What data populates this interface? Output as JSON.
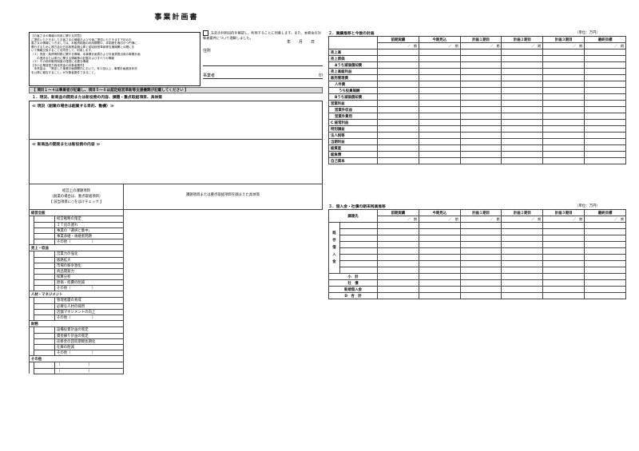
{
  "title": "事業計画書",
  "notice_lines": [
    "【お客さまの情報の利用に関する同意】",
    "ご提供いただきましたお客さまの情報および今後ご提供いただきます下記のお",
    "客さまの情報につきましては、本融資制度の利用期間中、本制度を適切かつ円滑に",
    "履行するために株式会社日本政策金融公庫と認定経営革新等支援機関との間にお",
    "いて情報交換することを同意して、利用します。",
    "（１）資産・負債等財務に関する情報、本事業計画書および計画書提出後の事業計画",
    "　　の進捗または実行に関する情報等の記載およびすべての情報",
    "（２）その他本融資制度の運営に必要な情報",
    "【中小企業経営力強化資金の対象者要件】",
    "　本資金は、「策定した事業計画期間内において、年１回以上、事業計画進捗状況",
    "を公庫に報告すること」が対象者要件であること。"
  ],
  "consent": {
    "text": "左記の利用目的を確認し、利用することに同意します。また、本資金の対象者要件について理解しました。",
    "date": "年　　月　　日",
    "address_label": "住所",
    "applicant_label": "事業者",
    "seal": "印"
  },
  "band_note": "【 項目１～４は事業者が記載し、項目５～６は認定経営革新等支援機関が記載してください 】",
  "section1": {
    "heading": "１．現況、新商品の開発または新役務の内容、課題・重点取組項目、具体策",
    "box1_label": "≪ 現況（創業の場合は創業する目的、動機）≫",
    "box2_label": "≪ 新商品の開発または新役務の内容 ≫"
  },
  "issues": {
    "header_left_1": "経営上の課題項目",
    "header_left_2": "（創業の場合は、重点取組項目）",
    "header_left_3": "【 該当項目に○をはけチェック 】",
    "header_right": "課題項目または重点取組項目を踏まえた具体策",
    "categories": [
      {
        "name": "経営全般",
        "items": [
          "経営戦略の策定",
          "ＩＴ化の遅れ",
          "事業の「選択と集中」",
          "事業承継・後継者問題",
          "その他（　　　　　　）"
        ]
      },
      {
        "name": "売上・収益",
        "items": [
          "営業力の強化",
          "販路拡大",
          "市場の競争激化",
          "商品開発力",
          "採算分析",
          "原価・経費の削減",
          "その他（　　　　　　）"
        ]
      },
      {
        "name": "人材・マネジメント",
        "items": [
          "管理者層の育成",
          "必要な人材の採用",
          "店舗マネジメントの向上",
          "その他（　　　　　　）"
        ]
      },
      {
        "name": "財務",
        "items": [
          "設備投資計画の策定",
          "資金繰り計画の策定",
          "売掛金の回収期間長期化",
          "在庫の削減",
          "その他（　　　　　　）"
        ]
      },
      {
        "name": "その他",
        "items": [
          "（　　　　　　　　）",
          "（　　　　　　　　）"
        ]
      }
    ]
  },
  "section2": {
    "heading": "２．業績推移と今後の計画",
    "unit": "（単位：万円）",
    "columns": [
      "前期実績",
      "今期見込",
      "計画１期目",
      "計画２期目",
      "計画３期目",
      "最終目標"
    ],
    "period_cell": "／　期",
    "rows": [
      {
        "label": "売上高",
        "indent": 0
      },
      {
        "label": "売上原価",
        "indent": 0
      },
      {
        "label": "Aうち減価償却費",
        "indent": 1
      },
      {
        "label": "売上高総利益",
        "indent": 0
      },
      {
        "label": "販売管理費",
        "indent": 0
      },
      {
        "label": "人件費",
        "indent": 1
      },
      {
        "label": "うち役員報酬",
        "indent": 2
      },
      {
        "label": "Bうち減価償却費",
        "indent": 1
      },
      {
        "label": "営業利益",
        "indent": 0
      },
      {
        "label": "営業外収益",
        "indent": 1
      },
      {
        "label": "営業外費用",
        "indent": 1
      },
      {
        "label": "C 経常利益",
        "indent": 0
      },
      {
        "label": "特別損益",
        "indent": 0
      },
      {
        "label": "法人税等",
        "indent": 0
      },
      {
        "label": "当期利益",
        "indent": 0
      },
      {
        "label": "総資産",
        "indent": 0
      },
      {
        "label": "総負債",
        "indent": 0
      },
      {
        "label": "自己資本",
        "indent": 0
      }
    ]
  },
  "section3": {
    "heading": "３．借入金・社債の期末残高推移",
    "unit": "（単位：万円）",
    "row_header": "調達先",
    "columns": [
      "前期実績",
      "今期見込",
      "計画１期目",
      "計画２期目",
      "計画３期目",
      "最終目標"
    ],
    "period_cell": "／　期",
    "vertical_label": [
      "既",
      "存",
      "借",
      "入",
      "金"
    ],
    "summary_rows": [
      "小　計",
      "社　債",
      "新規借入金",
      "D　合　計"
    ]
  }
}
